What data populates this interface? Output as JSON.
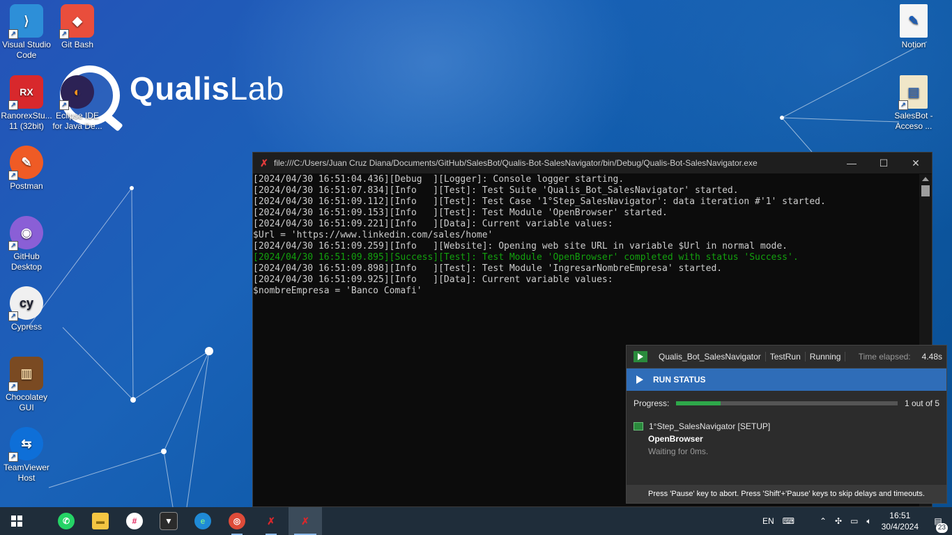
{
  "desktop": {
    "brand": {
      "part1": "Qualis",
      "part2": "Lab"
    },
    "icons_left": [
      {
        "label": "Visual Studio Code",
        "icon": "vscode-icon",
        "color": "#2d8fd8",
        "glyph": "⟩"
      },
      {
        "label": "Git Bash",
        "icon": "git-bash-icon",
        "color": "#e94e3c",
        "glyph": "◆"
      },
      {
        "label": "RanorexStu... 11 (32bit)",
        "icon": "ranorex-studio-icon",
        "color": "#d8282c",
        "glyph": "RX"
      },
      {
        "label": "Eclipse IDE for Java De...",
        "icon": "eclipse-icon",
        "color": "#2c2255",
        "glyph": "◐"
      },
      {
        "label": "Postman",
        "icon": "postman-icon",
        "color": "#ef5b25",
        "glyph": "✎"
      },
      {
        "label": "GitHub Desktop",
        "icon": "github-desktop-icon",
        "color": "#8a5fd6",
        "glyph": "◉"
      },
      {
        "label": "Cypress",
        "icon": "cypress-icon",
        "color": "#f0f0f0",
        "glyph": "cy"
      },
      {
        "label": "Chocolatey GUI",
        "icon": "chocolatey-icon",
        "color": "#7a4a22",
        "glyph": "▥"
      },
      {
        "label": "TeamViewer Host",
        "icon": "teamviewer-icon",
        "color": "#0e6fd8",
        "glyph": "⇆"
      }
    ],
    "icons_right": [
      {
        "label": "Notion",
        "icon": "notion-document-icon",
        "color": "#f5f5f5",
        "glyph": "✎"
      },
      {
        "label": "SalesBot - Acceso ...",
        "icon": "salesbot-shortcut-icon",
        "color": "#f0e6c8",
        "glyph": "▤"
      }
    ]
  },
  "console": {
    "title": "file:///C:/Users/Juan Cruz Diana/Documents/GitHub/SalesBot/Qualis-Bot-SalesNavigator/bin/Debug/Qualis-Bot-SalesNavigator.exe",
    "lines": [
      "[2024/04/30 16:51:04.436][Debug  ][Logger]: Console logger starting.",
      "[2024/04/30 16:51:07.834][Info   ][Test]: Test Suite 'Qualis_Bot_SalesNavigator' started.",
      "[2024/04/30 16:51:09.112][Info   ][Test]: Test Case '1°Step_SalesNavigator': data iteration #'1' started.",
      "[2024/04/30 16:51:09.153][Info   ][Test]: Test Module 'OpenBrowser' started.",
      "[2024/04/30 16:51:09.221][Info   ][Data]: Current variable values:",
      "$Url = 'https://www.linkedin.com/sales/home'",
      "[2024/04/30 16:51:09.259][Info   ][Website]: Opening web site URL in variable $Url in normal mode.",
      "[2024/04/30 16:51:09.895][Success][Test]: Test Module 'OpenBrowser' completed with status 'Success'.",
      "[2024/04/30 16:51:09.898][Info   ][Test]: Test Module 'IngresarNombreEmpresa' started.",
      "[2024/04/30 16:51:09.925][Info   ][Data]: Current variable values:",
      "$nombreEmpresa = 'Banco Comafi'"
    ],
    "success_line_index": 7,
    "success_color": "#13a10e"
  },
  "run_panel": {
    "suite": "Qualis_Bot_SalesNavigator",
    "run_config": "TestRun",
    "state": "Running",
    "elapsed_label": "Time elapsed:",
    "elapsed": "4.48s",
    "run_status_label": "RUN STATUS",
    "progress_label": "Progress:",
    "progress_fraction": 0.2,
    "progress_text": "1 out of 5",
    "test_case": "1°Step_SalesNavigator [SETUP]",
    "module": "OpenBrowser",
    "waiting": "Waiting for 0ms.",
    "footer": "Press 'Pause' key to abort. Press 'Shift'+'Pause' keys to skip delays and timeouts.",
    "accent": "#2f6db8"
  },
  "taskbar": {
    "apps": [
      {
        "name": "whatsapp-icon",
        "color": "#25d366",
        "glyph": "✆"
      },
      {
        "name": "file-explorer-icon",
        "color": "#f4c542",
        "glyph": "▬"
      },
      {
        "name": "slack-icon",
        "color": "#e01e5a",
        "glyph": "#"
      },
      {
        "name": "terminal-app-icon",
        "color": "#2b2b2b",
        "glyph": "▼"
      },
      {
        "name": "edge-icon",
        "color": "#1f8ad6",
        "glyph": "e"
      },
      {
        "name": "chrome-icon",
        "color": "#dd4b39",
        "glyph": "◎"
      },
      {
        "name": "ranorex-taskbar-icon",
        "color": "#d8282c",
        "glyph": "Rx"
      },
      {
        "name": "ranorex-active-taskbar-icon",
        "color": "#d8282c",
        "glyph": "Rx"
      }
    ],
    "language": "EN",
    "time": "16:51",
    "date": "30/4/2024",
    "notification_count": "23"
  }
}
